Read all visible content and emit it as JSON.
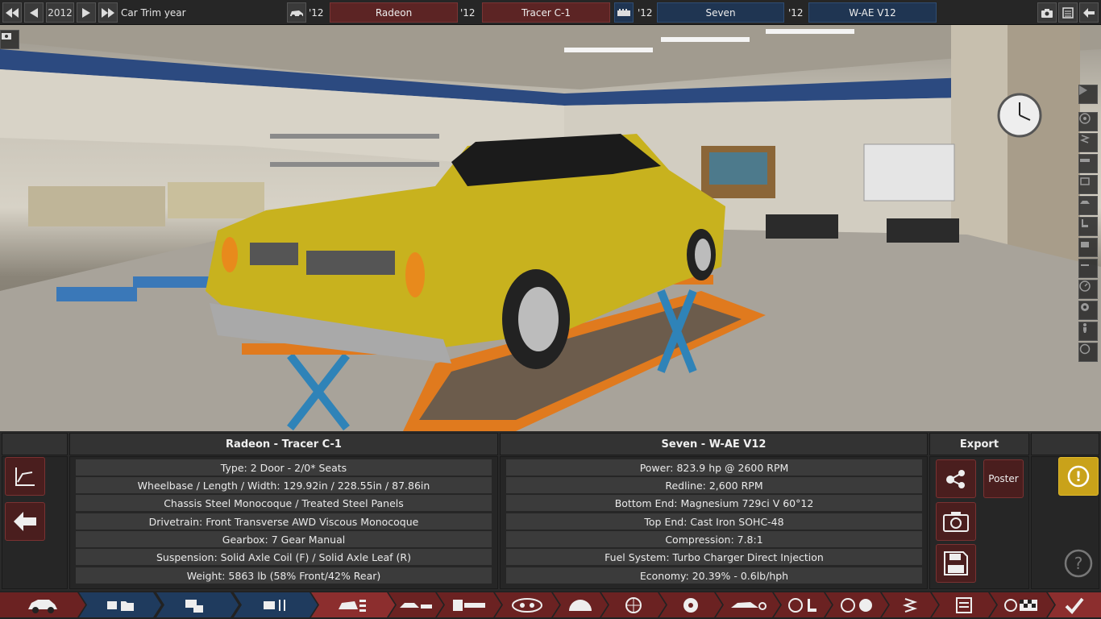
{
  "topbar": {
    "year": "2012",
    "year_label": "Car Trim year",
    "model_year_1": "'12",
    "model_name": "Radeon",
    "trim_year": "'12",
    "trim_name": "Tracer C-1",
    "family_year": "'12",
    "engine_family": "Seven",
    "variant_year": "'12",
    "engine_variant": "W-AE V12"
  },
  "panel": {
    "car_title": "Radeon - Tracer C-1",
    "engine_title": "Seven - W-AE V12",
    "export_title": "Export",
    "poster_label": "Poster",
    "car_stats": [
      "Type: 2 Door - 2/0* Seats",
      "Wheelbase / Length / Width: 129.92in / 228.55in / 87.86in",
      "Chassis Steel Monocoque / Treated Steel Panels",
      "Drivetrain: Front Transverse AWD Viscous Monocoque",
      "Gearbox: 7 Gear Manual",
      "Suspension: Solid Axle Coil (F) / Solid Axle Leaf (R)",
      "Weight: 5863 lb (58% Front/42% Rear)"
    ],
    "engine_stats": [
      "Power: 823.9 hp @ 2600 RPM",
      "Redline:  2,600 RPM",
      "Bottom End: Magnesium 729ci V 60°12",
      "Top End: Cast Iron SOHC-48",
      "Compression: 7.8:1",
      "Fuel System: Turbo Charger Direct Injection",
      "Economy: 20.39% - 0.6lb/hph"
    ],
    "help_glyph": "?",
    "warning_glyph": "!"
  },
  "colors": {
    "accent_red": "#6b2222",
    "accent_blue": "#1f3b5e",
    "car_body": "#c8b21e",
    "lift_orange": "#e07a1e"
  }
}
